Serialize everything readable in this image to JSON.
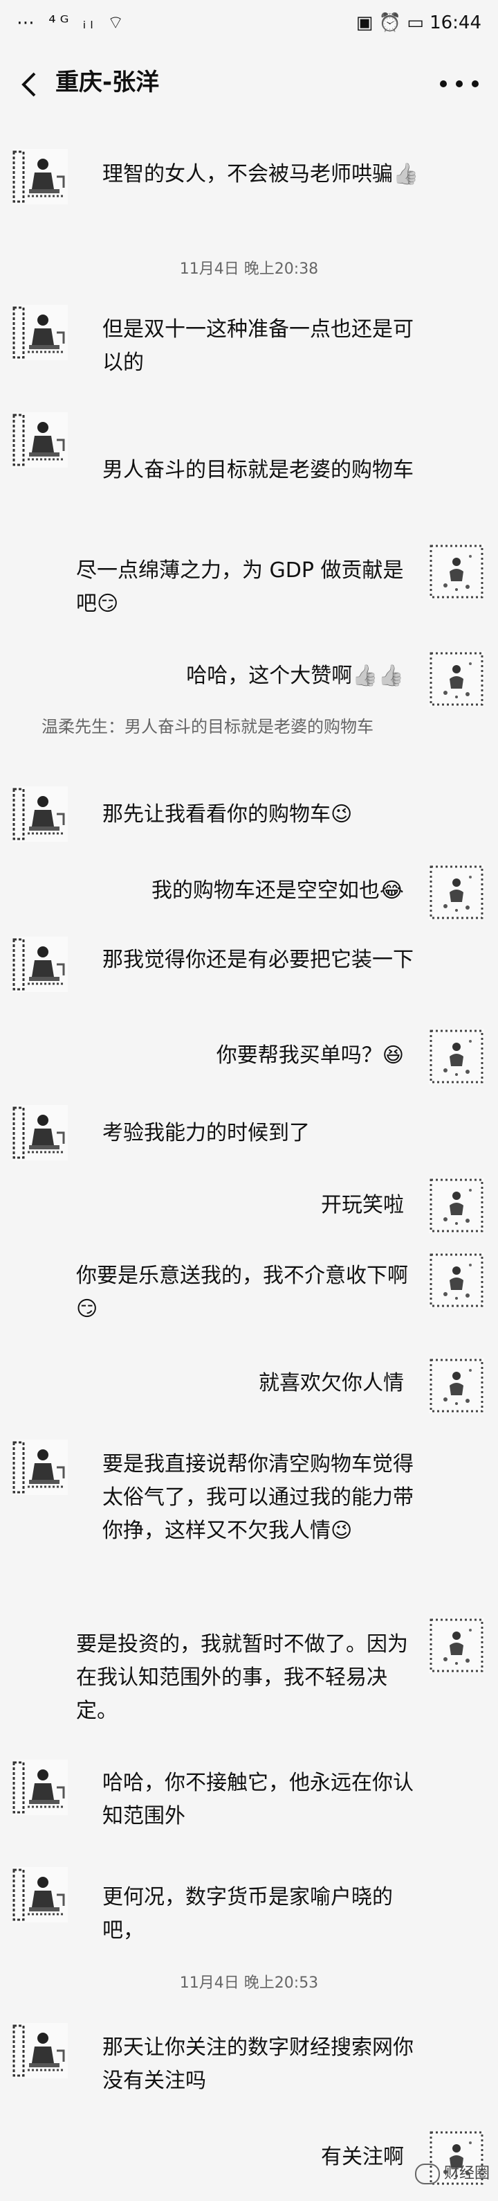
{
  "status_bar": {
    "left": "⋯ ⁴ᴳ ᵢₗ ⌔",
    "right": "▣ ⏰ ▭ 16:44"
  },
  "header": {
    "title": "重庆-张洋"
  },
  "messages": [
    {
      "side": "left",
      "text": "理智的女人，不会被马老师哄骗👍"
    },
    {
      "type": "time",
      "text": "11月4日 晚上20:38"
    },
    {
      "side": "left",
      "text": "但是双十一这种准备一点也还是可以的"
    },
    {
      "side": "left",
      "text": "男人奋斗的目标就是老婆的购物车"
    },
    {
      "side": "right",
      "text": "尽一点绵薄之力，为 GDP 做贡献是吧😏"
    },
    {
      "side": "right",
      "text": "哈哈，这个大赞啊👍👍"
    },
    {
      "type": "quote",
      "text": "温柔先生：男人奋斗的目标就是老婆的购物车"
    },
    {
      "side": "left",
      "text": "那先让我看看你的购物车😉"
    },
    {
      "side": "right",
      "text": "我的购物车还是空空如也😂"
    },
    {
      "side": "left",
      "text": "那我觉得你还是有必要把它装一下"
    },
    {
      "side": "right",
      "text": "你要帮我买单吗？😆"
    },
    {
      "side": "left",
      "text": "考验我能力的时候到了"
    },
    {
      "side": "right",
      "text": "开玩笑啦"
    },
    {
      "side": "right",
      "text": "你要是乐意送我的，我不介意收下啊😏"
    },
    {
      "side": "right",
      "text": "就喜欢欠你人情"
    },
    {
      "side": "left",
      "text": "要是我直接说帮你清空购物车觉得太俗气了，我可以通过我的能力带你挣，这样又不欠我人情😉"
    },
    {
      "side": "right",
      "text": "要是投资的，我就暂时不做了。因为在我认知范围外的事，我不轻易决定。"
    },
    {
      "side": "left",
      "text": "哈哈，你不接触它，他永远在你认知范围外"
    },
    {
      "side": "left",
      "text": "更何况，数字货币是家喻户晓的吧，"
    },
    {
      "type": "time",
      "text": "11月4日 晚上20:53"
    },
    {
      "side": "left",
      "text": "那天让你关注的数字财经搜索网你没有关注吗"
    },
    {
      "side": "right",
      "text": "有关注啊"
    }
  ],
  "watermark": {
    "text": "财经圈"
  }
}
